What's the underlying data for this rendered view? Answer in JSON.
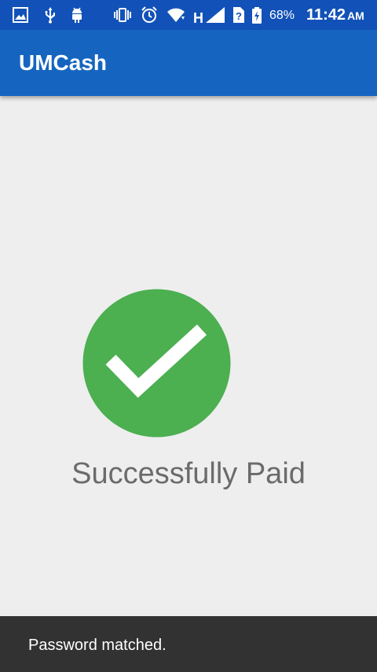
{
  "status_bar": {
    "battery_percent": "68%",
    "time": "11:42",
    "ampm": "AM",
    "icons": [
      "gallery-icon",
      "usb-icon",
      "android-debug-icon",
      "vibrate-icon",
      "alarm-icon",
      "wifi-icon",
      "signal-h-icon",
      "sim-unknown-icon",
      "battery-charging-icon"
    ]
  },
  "app_bar": {
    "title": "UMCash"
  },
  "main": {
    "status_icon": "checkmark-circle-icon",
    "status_message": "Successfully Paid"
  },
  "snackbar": {
    "message": "Password matched."
  },
  "colors": {
    "status_bar": "#1252b8",
    "app_bar": "#1565c0",
    "background": "#eeeeee",
    "success_green": "#4caf50",
    "message_text": "#6b6b6b",
    "snackbar": "#323232"
  }
}
